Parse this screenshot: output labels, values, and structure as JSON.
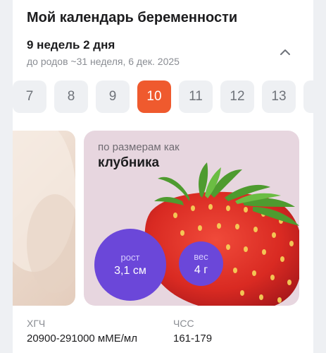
{
  "header": {
    "title": "Мой календарь беременности"
  },
  "week_info": {
    "current": "9 недель 2 дня",
    "subtitle": "до родов ~31 неделя, 6 дек. 2025"
  },
  "weeks": [
    "7",
    "8",
    "9",
    "10",
    "11",
    "12",
    "13"
  ],
  "active_week": "10",
  "fruit": {
    "label": "по размерам как",
    "name": "клубника",
    "height_label": "рост",
    "height_value": "3,1 см",
    "weight_label": "вес",
    "weight_value": "4 г"
  },
  "stats": {
    "hcg_label": "ХГЧ",
    "hcg_value": "20900-291000 мМЕ/мл",
    "hr_label": "ЧСС",
    "hr_value": "161-179"
  },
  "colors": {
    "accent": "#ef5a2e",
    "bubble": "#6b47d9",
    "fruit_card_bg": "#e7d6df"
  }
}
